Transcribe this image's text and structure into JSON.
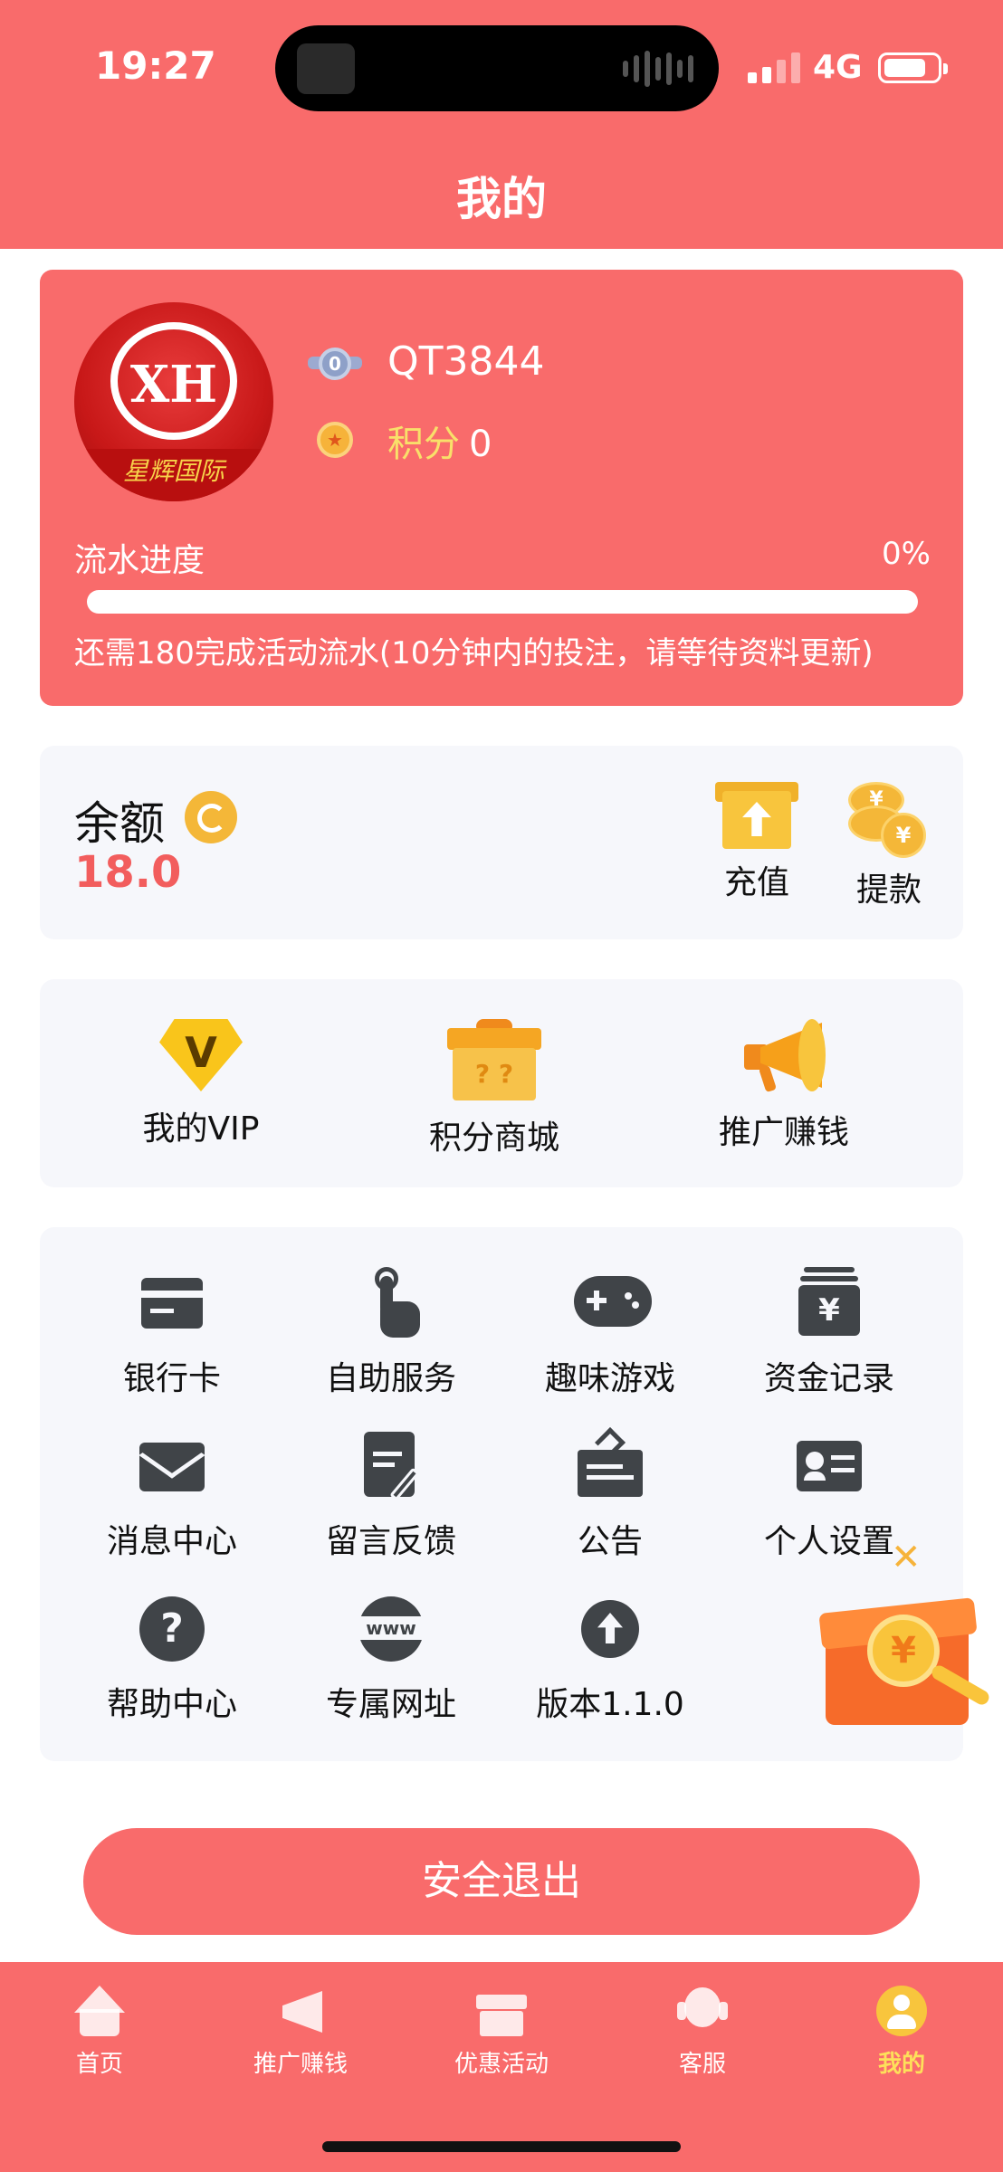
{
  "status_bar": {
    "time": "19:27",
    "network": "4G",
    "signal_bars": 2,
    "battery_percent": 80
  },
  "header": {
    "title": "我的"
  },
  "profile": {
    "avatar_alt": "XH 星辉国际 logo",
    "avatar_mono": "XH",
    "avatar_band": "星辉国际",
    "level_badge": "0",
    "username": "QT3844",
    "points_label": "积分",
    "points_value": "0",
    "progress_label": "流水进度",
    "progress_percent_text": "0%",
    "progress_fraction": 0,
    "progress_note": "还需180完成活动流水(10分钟内的投注，请等待资料更新)"
  },
  "balance": {
    "label": "余额",
    "value": "18.0",
    "recharge_label": "充值",
    "withdraw_label": "提款",
    "currency_symbol": "¥"
  },
  "features": [
    {
      "label": "我的VIP",
      "icon": "vip-diamond-icon"
    },
    {
      "label": "积分商城",
      "icon": "gift-box-icon"
    },
    {
      "label": "推广赚钱",
      "icon": "megaphone-icon"
    }
  ],
  "menu": [
    {
      "label": "银行卡",
      "icon": "bank-card-icon"
    },
    {
      "label": "自助服务",
      "icon": "tap-hand-icon"
    },
    {
      "label": "趣味游戏",
      "icon": "gamepad-icon"
    },
    {
      "label": "资金记录",
      "icon": "fund-record-icon"
    },
    {
      "label": "消息中心",
      "icon": "mail-icon"
    },
    {
      "label": "留言反馈",
      "icon": "feedback-icon"
    },
    {
      "label": "公告",
      "icon": "notice-board-icon"
    },
    {
      "label": "个人设置",
      "icon": "id-card-icon"
    },
    {
      "label": "帮助中心",
      "icon": "help-icon"
    },
    {
      "label": "专属网址",
      "icon": "www-icon"
    },
    {
      "label": "版本1.1.0",
      "icon": "upload-icon"
    }
  ],
  "floating_gift": {
    "close_glyph": "✕",
    "coin_symbol": "¥"
  },
  "logout": {
    "label": "安全退出"
  },
  "tabbar": {
    "tabs": [
      {
        "label": "首页",
        "icon": "home-icon",
        "active": false
      },
      {
        "label": "推广赚钱",
        "icon": "megaphone-icon",
        "active": false
      },
      {
        "label": "优惠活动",
        "icon": "gift-icon",
        "active": false
      },
      {
        "label": "客服",
        "icon": "headset-icon",
        "active": false
      },
      {
        "label": "我的",
        "icon": "user-icon",
        "active": true
      }
    ]
  },
  "colors": {
    "brand_red": "#f96b6b",
    "balance_red": "#f25d5d",
    "points_yellow": "#f9e06a",
    "active_tab": "#fde05a",
    "card_bg": "#f6f7fb",
    "icon_dark": "#404448"
  }
}
